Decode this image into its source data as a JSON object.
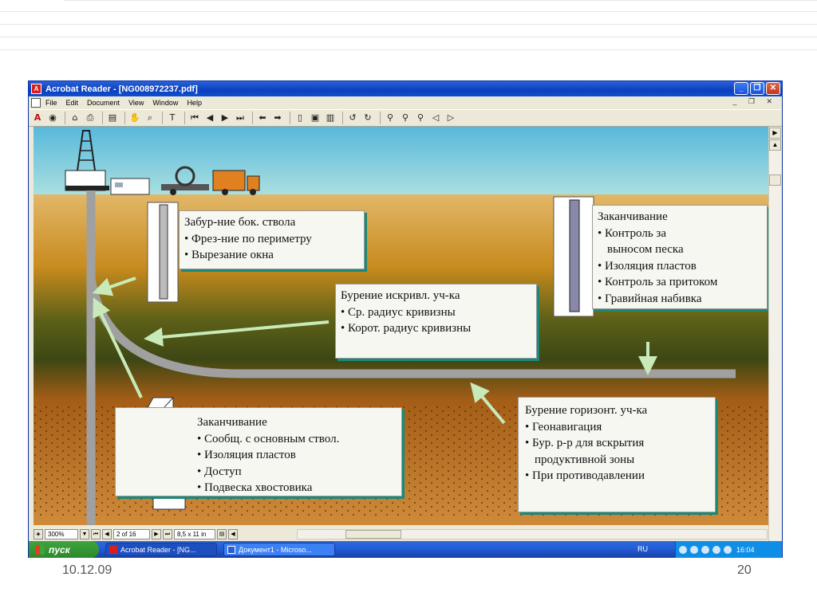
{
  "window": {
    "title": "Acrobat Reader - [NG008972237.pdf]",
    "menu": [
      "File",
      "Edit",
      "Document",
      "View",
      "Window",
      "Help"
    ]
  },
  "toolbar_icons": [
    "acrobat-icon",
    "get-info-icon",
    "open-icon",
    "print-icon",
    "show-hide-navigation-icon",
    "hand-tool-icon",
    "zoom-tool-icon",
    "text-select-tool-icon",
    "first-page-icon",
    "previous-page-icon",
    "next-page-icon",
    "last-page-icon",
    "go-back-icon",
    "go-forward-icon",
    "actual-size-icon",
    "fit-page-icon",
    "fit-width-icon",
    "rotate-left-icon",
    "rotate-right-icon",
    "find-icon",
    "search-icon",
    "search-results-icon",
    "previous-highlight-icon",
    "next-highlight-icon"
  ],
  "document": {
    "callouts": [
      {
        "id": "sidetrack",
        "heading": "Забур-ние бок. ствола",
        "items": [
          "• Фрез-ние по периметру",
          "• Вырезание окна"
        ]
      },
      {
        "id": "completion-right",
        "heading": "Заканчивание",
        "items": [
          "• Контроль за",
          "выносом песка",
          "• Изоляция пластов",
          "• Контроль за притоком",
          "• Гравийная набивка"
        ]
      },
      {
        "id": "curve-drilling",
        "heading": "Бурение искривл. уч-ка",
        "items": [
          "• Ср. радиус кривизны",
          "• Корот. радиус кривизны"
        ]
      },
      {
        "id": "completion-left",
        "heading": "Заканчивание",
        "items": [
          "• Сообщ. с основным ствол.",
          "• Изоляция пластов",
          "• Доступ",
          "• Подвеска хвостовика"
        ]
      },
      {
        "id": "horizontal-drilling",
        "heading": "Бурение горизонт. уч-ка",
        "items": [
          "• Геонавигация",
          "• Бур. р-р для вскрытия",
          "продуктивной зоны",
          "• При противодавлении"
        ]
      }
    ]
  },
  "statusbar": {
    "zoom": "300%",
    "page": "2 of 16",
    "page_size": "8,5 x 11 in"
  },
  "taskbar": {
    "start_label": "пуск",
    "tasks": [
      "Acrobat Reader - [NG...",
      "Документ1 - Microso..."
    ],
    "language": "RU",
    "clock": "16:04"
  },
  "slide_footer": {
    "date": "10.12.09",
    "page_number": "20"
  },
  "colors": {
    "sky": "#6fc6df",
    "soil_top": "#c58a1e",
    "soil_dark": "#3f4a14",
    "soil_bottom": "#a8541a",
    "callout_shadow": "#1a8a78",
    "arrow": "#c8eab8",
    "well_path": "#a0a0a0"
  }
}
